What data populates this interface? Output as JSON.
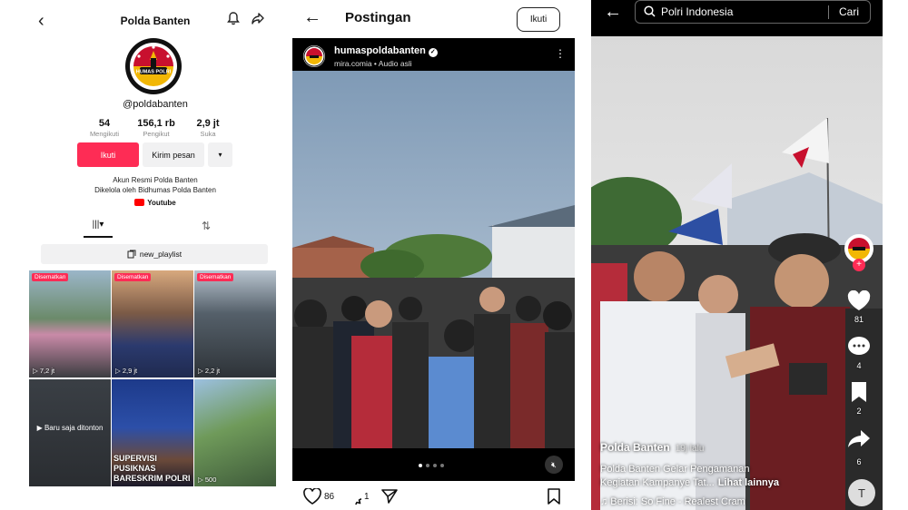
{
  "tiktok_profile": {
    "title": "Polda Banten",
    "handle": "@poldabanten",
    "stats": [
      {
        "value": "54",
        "label": "Mengikuti"
      },
      {
        "value": "156,1 rb",
        "label": "Pengikut"
      },
      {
        "value": "2,9 jt",
        "label": "Suka"
      }
    ],
    "follow_label": "Ikuti",
    "message_label": "Kirim pesan",
    "more_label": "▾",
    "bio_line1": "Akun Resmi Polda Banten",
    "bio_line2": "Dikelola oleh Bidhumas Polda Banten",
    "link_label": "Youtube",
    "playlist_label": "new_playlist",
    "videos": [
      {
        "badge": "Disematkan",
        "views": "7,2 jt"
      },
      {
        "badge": "Disematkan",
        "views": "2,9 jt"
      },
      {
        "badge": "Disematkan",
        "views": "2,2 jt"
      },
      {
        "watched": "Baru saja ditonton"
      },
      {
        "caption": "SUPERVISI PUSIKNAS BARESKRIM POLRI"
      },
      {
        "views": "500"
      }
    ],
    "logo_text": "HUMAS POLRI"
  },
  "instagram_post": {
    "title": "Postingan",
    "follow_label": "Ikuti",
    "username": "humaspoldabanten",
    "subtitle": "mira.comia • Audio asli",
    "likes": "86",
    "comments": "1"
  },
  "tiktok_video": {
    "search_query": "Polri Indonesia",
    "search_button": "Cari",
    "likes": "81",
    "comments": "4",
    "saves": "2",
    "shares": "6",
    "username": "Polda Banten",
    "time_ago": "19j lalu",
    "caption_line1": "Polda Banten Gelar Pengamanan",
    "caption_line2": "Kegiatan Kampanye Tat...",
    "see_more": "Lihat lainnya",
    "music": "♫ Berisi: So Fine - Realest Cram"
  },
  "colors": {
    "tiktok_red": "#fe2c55",
    "police_red": "#c8102e",
    "police_gold": "#f2b705"
  }
}
